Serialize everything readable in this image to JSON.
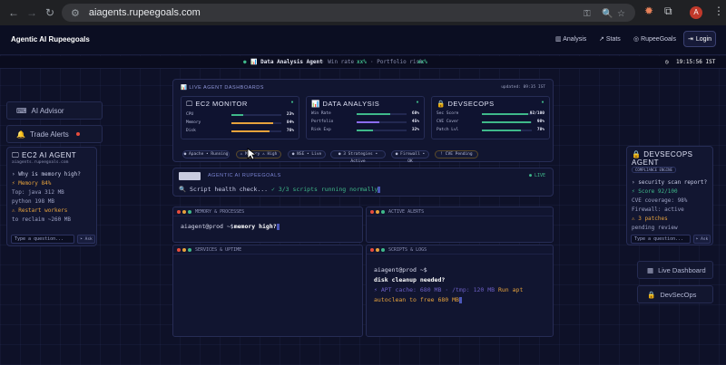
{
  "browser": {
    "url": "aiagents.rupeegoals.com",
    "avatar_letter": "A"
  },
  "nav": {
    "brand": "Agentic AI Rupeegoals",
    "links": [
      "Analysis",
      "Stats",
      "RupeeGoals"
    ],
    "login": "Login"
  },
  "ticker": {
    "agent": "📊 Data Analysis Agent",
    "win_label": "· Win rate",
    "win_value": "xx%",
    "port_label": "· Portfolio risk",
    "port_value": "xx%",
    "clock": "19:15:56 IST"
  },
  "left": {
    "ai_advisor": "AI Advisor",
    "trade_alerts": "Trade Alerts"
  },
  "ec2_agent": {
    "title": "EC2 AI AGENT",
    "subtitle": "aiagents.rupeegoals.com",
    "lines": [
      "› Why is memory high?",
      "⚡ Memory 84%",
      "Top: java 312 MB",
      "python 198 MB",
      "⚠ Restart workers",
      "to reclaim ~260 MB"
    ],
    "placeholder": "Type a question...",
    "ask": "➤ Ask"
  },
  "devsec_agent": {
    "title": "DEVSECOPS AGENT",
    "badge": "COMPLIANCE ENGINE",
    "lines": [
      "› security scan report?",
      "⚡ Score 92/100",
      "CVE coverage: 98%",
      "Firewall: active",
      "⚠ 3 patches",
      "pending review"
    ],
    "placeholder": "Type a question...",
    "ask": "➤ Ask"
  },
  "right": {
    "live_dashboard": "Live Dashboard",
    "devsecops": "DevSecOps"
  },
  "dash": {
    "header": "📊 LIVE AGENT DASHBOARDS",
    "updated": "updated: 09:35 IST",
    "cards": [
      {
        "title": "EC2 MONITOR",
        "rows": [
          {
            "label": "CPU",
            "value": "23%",
            "pct": 0.23,
            "color": "#3fb98a"
          },
          {
            "label": "Memory",
            "value": "84%",
            "pct": 0.84,
            "color": "#e6a23c"
          },
          {
            "label": "Disk",
            "value": "76%",
            "pct": 0.76,
            "color": "#e6a23c"
          }
        ]
      },
      {
        "title": "DATA ANALYSIS",
        "rows": [
          {
            "label": "Win Rate",
            "value": "68%",
            "pct": 0.68,
            "color": "#3fb98a"
          },
          {
            "label": "Portfolio",
            "value": "45%",
            "pct": 0.45,
            "color": "#8b6cf0"
          },
          {
            "label": "Risk Exp",
            "value": "32%",
            "pct": 0.32,
            "color": "#3fb98a"
          }
        ]
      },
      {
        "title": "DEVSECOPS",
        "rows": [
          {
            "label": "Sec Score",
            "value": "92/100",
            "pct": 0.92,
            "color": "#3fb98a"
          },
          {
            "label": "CVE Cover",
            "value": "98%",
            "pct": 0.98,
            "color": "#3fb98a"
          },
          {
            "label": "Patch Lvl",
            "value": "78%",
            "pct": 0.78,
            "color": "#3fb98a"
          }
        ]
      }
    ],
    "pills": [
      "● Apache • Running",
      "⚠ Memory ⚠ High",
      "● NSE • Live",
      "● 3 Strategies • Active",
      "● Firewall • OK",
      "! CVE Pending"
    ]
  },
  "termbar": {
    "title": "AGENTIC AI RUPEEGOALS",
    "live": "● LIVE",
    "line": "🔍 Script health check...",
    "ok": "✓ 3/3 scripts running normally"
  },
  "terminals": {
    "mem": {
      "title": "MEMORY & PROCESSES",
      "prompt": "aiagent@prod ~$",
      "cmd": "memory high?"
    },
    "alerts": {
      "title": "ACTIVE ALERTS"
    },
    "services": {
      "title": "SERVICES & UPTIME"
    },
    "scripts": {
      "title": "SCRIPTS & LOGS",
      "prompt": "aiagent@prod ~$",
      "cmd": "disk cleanup needed?",
      "resp1": "⚡ APT cache: 680 MB · /tmp: 120 MB",
      "resp2": "Run apt",
      "resp3": "autoclean to free 680 MB"
    }
  }
}
